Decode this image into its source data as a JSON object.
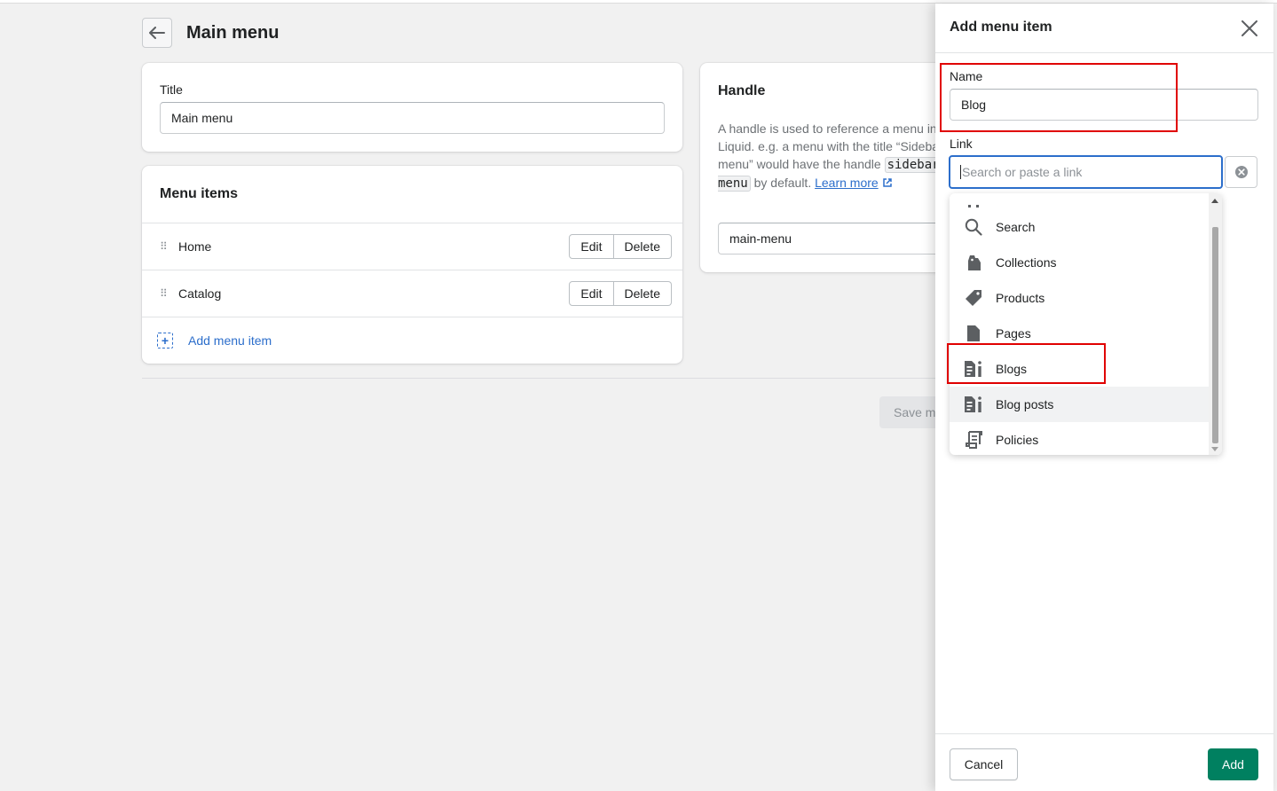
{
  "page": {
    "title": "Main menu",
    "back_icon": "arrow-left-icon"
  },
  "title_card": {
    "label": "Title",
    "value": "Main menu"
  },
  "menu_items_card": {
    "heading": "Menu items",
    "items": [
      {
        "label": "Home",
        "edit_label": "Edit",
        "delete_label": "Delete"
      },
      {
        "label": "Catalog",
        "edit_label": "Edit",
        "delete_label": "Delete"
      }
    ],
    "add_label": "Add menu item"
  },
  "handle_card": {
    "heading": "Handle",
    "text_before": "A handle is used to reference a menu in Liquid. e.g. a menu with the title “Sidebar menu” would have the handle",
    "code": "sidebar-menu",
    "text_after": "by default.",
    "learn_more": "Learn more",
    "value": "main-menu"
  },
  "save_label": "Save menu",
  "drawer": {
    "title": "Add menu item",
    "name_label": "Name",
    "name_value": "Blog",
    "link_label": "Link",
    "link_placeholder": "Search or paste a link",
    "dropdown": [
      {
        "label": "Search",
        "icon": "search-icon"
      },
      {
        "label": "Collections",
        "icon": "collections-icon"
      },
      {
        "label": "Products",
        "icon": "tag-icon"
      },
      {
        "label": "Pages",
        "icon": "page-icon"
      },
      {
        "label": "Blogs",
        "icon": "blog-icon"
      },
      {
        "label": "Blog posts",
        "icon": "blog-icon"
      },
      {
        "label": "Policies",
        "icon": "policy-icon"
      }
    ],
    "cancel_label": "Cancel",
    "add_label": "Add"
  },
  "colors": {
    "primary_button": "#008060",
    "link": "#2c6ecb",
    "highlight_box": "#e00000"
  }
}
